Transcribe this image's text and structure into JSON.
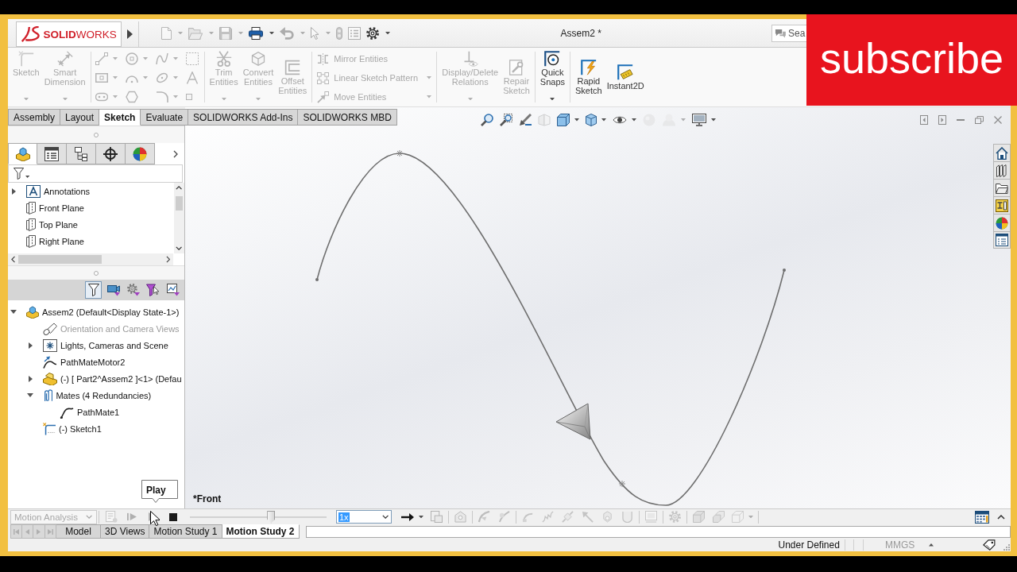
{
  "window": {
    "brand": "**SOLID**WORKS",
    "title": "Assem2 *"
  },
  "quick_access": [
    {
      "kind": "new",
      "disabled": true,
      "dropdown": true
    },
    {
      "kind": "open",
      "disabled": true,
      "dropdown": true
    },
    {
      "kind": "save",
      "disabled": true,
      "dropdown": true
    },
    {
      "kind": "print",
      "disabled": false,
      "dropdown": true
    },
    {
      "kind": "undo",
      "disabled": true,
      "dropdown": true
    },
    {
      "kind": "select",
      "disabled": true,
      "dropdown": true
    },
    {
      "kind": "rebuild",
      "disabled": true,
      "dropdown": false
    },
    {
      "kind": "properties",
      "disabled": true,
      "dropdown": false
    },
    {
      "kind": "options",
      "disabled": false,
      "dropdown": true
    }
  ],
  "search": {
    "placeholder": "Sea"
  },
  "ribbon": {
    "groups": [
      {
        "kind": "large",
        "tools": [
          {
            "kind": "sketch",
            "label": "Sketch",
            "disabled": true,
            "dropdown": true
          },
          {
            "kind": "dimension",
            "label": "Smart Dimension",
            "disabled": true,
            "dropdown": true
          }
        ]
      },
      {
        "kind": "grid",
        "tools": [
          {
            "kind": "line",
            "disabled": true,
            "dropdown": true
          },
          {
            "kind": "circle",
            "disabled": true,
            "dropdown": true
          },
          {
            "kind": "spline",
            "disabled": true,
            "dropdown": true
          },
          {
            "kind": "frame",
            "disabled": true,
            "dropdown": false
          },
          {
            "kind": "rectangle",
            "disabled": true,
            "dropdown": true
          },
          {
            "kind": "arc",
            "disabled": true,
            "dropdown": true
          },
          {
            "kind": "ellipse",
            "disabled": true,
            "dropdown": true
          },
          {
            "kind": "text",
            "disabled": true,
            "dropdown": false
          },
          {
            "kind": "slot",
            "disabled": true,
            "dropdown": true
          },
          {
            "kind": "polygon",
            "disabled": true,
            "dropdown": false
          },
          {
            "kind": "fillet",
            "disabled": true,
            "dropdown": true
          },
          {
            "kind": "point",
            "disabled": true,
            "dropdown": false
          }
        ]
      },
      {
        "kind": "large",
        "tools": [
          {
            "kind": "trim",
            "label": "Trim Entities",
            "disabled": true,
            "dropdown": true
          },
          {
            "kind": "convert",
            "label": "Convert Entities",
            "disabled": true,
            "dropdown": true
          },
          {
            "kind": "offset",
            "label": "Offset Entities",
            "disabled": true,
            "dropdown": false
          }
        ]
      },
      {
        "kind": "rows",
        "tools": [
          {
            "kind": "mirror",
            "label": "Mirror Entities",
            "disabled": true,
            "dropdown": false
          },
          {
            "kind": "pattern",
            "label": "Linear Sketch Pattern",
            "disabled": true,
            "dropdown": true
          },
          {
            "kind": "move",
            "label": "Move Entities",
            "disabled": true,
            "dropdown": true
          }
        ]
      },
      {
        "kind": "large",
        "tools": [
          {
            "kind": "relations",
            "label": "Display/Delete Relations",
            "disabled": true,
            "dropdown": true
          },
          {
            "kind": "repair",
            "label": "Repair Sketch",
            "disabled": true,
            "dropdown": false
          }
        ]
      },
      {
        "kind": "large",
        "tools": [
          {
            "kind": "snaps",
            "label": "Quick Snaps",
            "disabled": false,
            "dropdown": true
          }
        ]
      },
      {
        "kind": "large",
        "tools": [
          {
            "kind": "rapid",
            "label": "Rapid Sketch",
            "disabled": false,
            "dropdown": false
          },
          {
            "kind": "instant",
            "label": "Instant2D",
            "disabled": false,
            "dropdown": false
          }
        ]
      }
    ]
  },
  "tabs": [
    {
      "label": "Assembly",
      "selected": false
    },
    {
      "label": "Layout",
      "selected": false
    },
    {
      "label": "Sketch",
      "selected": true
    },
    {
      "label": "Evaluate",
      "selected": false
    },
    {
      "label": "SOLIDWORKS Add-Ins",
      "selected": false
    },
    {
      "label": "SOLIDWORKS MBD",
      "selected": false
    }
  ],
  "feature_panel": {
    "tabs": [
      {
        "kind": "feature",
        "selected": true
      },
      {
        "kind": "property",
        "selected": false
      },
      {
        "kind": "config",
        "selected": false
      },
      {
        "kind": "dimxpert",
        "selected": false
      },
      {
        "kind": "display",
        "selected": false
      }
    ],
    "tree": [
      {
        "label": "Annotations",
        "kind": "annotations",
        "expanded": false
      },
      {
        "label": "Front Plane",
        "kind": "plane"
      },
      {
        "label": "Top Plane",
        "kind": "plane"
      },
      {
        "label": "Right Plane",
        "kind": "plane"
      }
    ],
    "filters": [
      {
        "kind": "filter",
        "selected": true
      },
      {
        "kind": "camera",
        "selected": false
      },
      {
        "kind": "gear",
        "selected": false
      },
      {
        "kind": "funnel",
        "selected": false
      },
      {
        "kind": "plot",
        "selected": false
      }
    ],
    "motion_tree": [
      {
        "label": "Assem2 (Default<Display State-1>)",
        "kind": "assembly",
        "expanded": true,
        "dimmed": false,
        "children": [
          {
            "label": "Orientation and Camera Views",
            "kind": "camera",
            "dimmed": true
          },
          {
            "label": "Lights, Cameras and Scene",
            "kind": "lights",
            "expanded": false,
            "dimmed": false
          },
          {
            "label": "PathMateMotor2",
            "kind": "motor",
            "dimmed": false
          },
          {
            "label": "(-) [ Part2^Assem2 ]<1> (Defau",
            "kind": "part",
            "expanded": false,
            "dimmed": false
          },
          {
            "label": "Mates (4 Redundancies)",
            "kind": "mates",
            "expanded": true,
            "dimmed": false,
            "children": [
              {
                "label": "PathMate1",
                "kind": "mate",
                "dimmed": false
              }
            ]
          },
          {
            "label": "(-) Sketch1",
            "kind": "sketch",
            "dimmed": false
          }
        ]
      }
    ]
  },
  "viewport": {
    "view_tools": [
      {
        "kind": "zoomfit",
        "disabled": false,
        "dropdown": false
      },
      {
        "kind": "zoomarea",
        "disabled": false,
        "dropdown": false
      },
      {
        "kind": "previous",
        "disabled": false,
        "dropdown": false
      },
      {
        "kind": "section",
        "disabled": true,
        "dropdown": false
      },
      {
        "kind": "orientation",
        "disabled": false,
        "dropdown": true
      },
      {
        "kind": "display",
        "disabled": false,
        "dropdown": true
      },
      {
        "kind": "visibility",
        "disabled": false,
        "dropdown": true
      },
      {
        "kind": "appearance",
        "disabled": true,
        "dropdown": false
      },
      {
        "kind": "scene",
        "disabled": true,
        "dropdown": true
      },
      {
        "kind": "settings",
        "disabled": false,
        "dropdown": true
      }
    ],
    "view_label": "*Front"
  },
  "motion": {
    "study_type": {
      "value": "Motion Analysis",
      "disabled": true
    },
    "transport": [
      {
        "kind": "calculate",
        "disabled": true
      },
      {
        "kind": "start",
        "disabled": true
      },
      {
        "kind": "play",
        "disabled": true
      },
      {
        "kind": "stop",
        "disabled": false
      }
    ],
    "tooltip": "Play",
    "timeline": {
      "level": 0.6
    },
    "speed": {
      "value": "1x",
      "highlighted": true
    },
    "tool_groups": [
      [
        {
          "kind": "arrow",
          "disabled": false,
          "dropdown": true
        },
        {
          "kind": "film",
          "disabled": true,
          "dropdown": false
        }
      ],
      [
        {
          "kind": "wizard",
          "disabled": true,
          "dropdown": false
        }
      ],
      [
        {
          "kind": "autokey",
          "disabled": true,
          "dropdown": false
        },
        {
          "kind": "key",
          "disabled": true,
          "dropdown": false
        }
      ],
      [
        {
          "kind": "motor",
          "disabled": true,
          "dropdown": false
        },
        {
          "kind": "spring",
          "disabled": true,
          "dropdown": false
        },
        {
          "kind": "damper",
          "disabled": true,
          "dropdown": false
        },
        {
          "kind": "force",
          "disabled": true,
          "dropdown": false
        },
        {
          "kind": "contact",
          "disabled": true,
          "dropdown": false
        },
        {
          "kind": "gravity",
          "disabled": true,
          "dropdown": false
        }
      ],
      [
        {
          "kind": "results",
          "disabled": true,
          "dropdown": false
        }
      ],
      [
        {
          "kind": "gear",
          "disabled": true,
          "dropdown": false
        }
      ],
      [
        {
          "kind": "collapse",
          "disabled": true,
          "dropdown": false
        },
        {
          "kind": "expand",
          "disabled": true,
          "dropdown": false
        },
        {
          "kind": "tree",
          "disabled": true,
          "dropdown": true
        }
      ]
    ]
  },
  "study_nav": [
    {
      "kind": "first",
      "disabled": true
    },
    {
      "kind": "previous",
      "disabled": true
    },
    {
      "kind": "next",
      "disabled": true
    },
    {
      "kind": "last",
      "disabled": true
    }
  ],
  "study_tabs": [
    {
      "label": "Model",
      "selected": false
    },
    {
      "label": "3D Views",
      "selected": false
    },
    {
      "label": "Motion Study 1",
      "selected": false
    },
    {
      "label": "Motion Study 2",
      "selected": true
    }
  ],
  "status_bar": {
    "sketch_state": "Under Defined",
    "units": "MMGS"
  },
  "banner": {
    "text": "subscribe"
  }
}
